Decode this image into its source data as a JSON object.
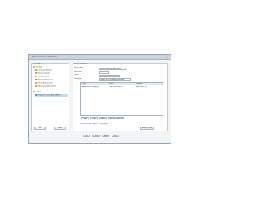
{
  "window": {
    "title": "Advanced Group Definition",
    "close_glyph": "×"
  },
  "left_panel": {
    "header": "Group Tree",
    "groups": [
      {
        "label": "Standard",
        "items": [
          {
            "label": "Information Analyst",
            "color": "#e07b26"
          },
          {
            "label": "Business Analyst",
            "color": "#e07b26"
          },
          {
            "label": "Backup Operator",
            "color": "#e07b26"
          },
          {
            "label": "Network Administrator",
            "color": "#d9534f"
          },
          {
            "label": "Server Administrator",
            "color": "#e07b26"
          },
          {
            "label": "Workstation Administrator",
            "color": "#e07b26"
          }
        ]
      },
      {
        "label": "Custom",
        "items": [
          {
            "label": "Replicated Group (BAS DEMO)",
            "color": "#3a7bd5",
            "selected": true
          }
        ]
      }
    ],
    "buttons": {
      "new": "New",
      "delete": "Delete"
    }
  },
  "right_panel": {
    "header": "Group Definition",
    "fields": {
      "group_name": {
        "label": "Group name:",
        "value": "Replicated Group (BAS DEMO)"
      },
      "group_type": {
        "label": "Group type:",
        "value": "Standard"
      },
      "owner": {
        "label": "Owner:",
        "value": "Default"
      },
      "description": {
        "label": "Description:",
        "value": "Trigger: If any condition is satisfied"
      }
    },
    "table": {
      "columns": [
        "Object",
        "Source",
        "Condition"
      ],
      "rows": [
        [
          "Administrators (local group)",
          "LDAP-DOM-DEMO-DC",
          "Equal (Jan 22 0°)"
        ]
      ]
    },
    "table_buttons": [
      "Add",
      "Edit",
      "Remove",
      "Move up",
      "Move down"
    ],
    "footer_text": "Group Recursion (Objects — Sub groups)",
    "evaluate_button": "Evaluate Group"
  },
  "bottom_buttons": [
    "OK",
    "Cancel",
    "Apply",
    "Help"
  ]
}
